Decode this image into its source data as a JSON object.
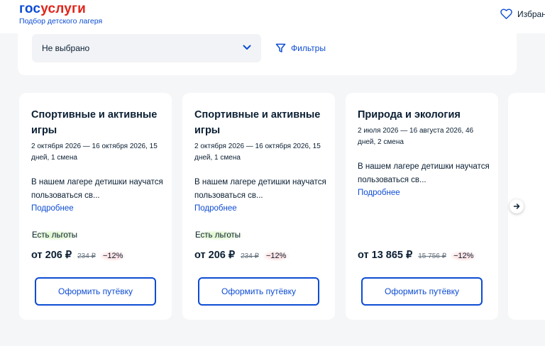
{
  "header": {
    "logo_part1": "гос",
    "logo_part2": "услуги",
    "subtitle": "Подбор детского лагеря",
    "favorites_label": "Избран"
  },
  "filter_bar": {
    "select_value": "Не выбрано",
    "filters_label": "Фильтры"
  },
  "cards": [
    {
      "title": "Спортивные и активные игры",
      "dates": "2 октября 2026 — 16 октября 2026, 15 дней, 1 смена",
      "description": "В нашем лагере детишки научатся пользоваться св...",
      "more_label": "Подробнее",
      "benefit": "Есть льготы",
      "price": "от 206 ₽",
      "old_price": "234 ₽",
      "discount": "−12%",
      "button_label": "Оформить путёвку"
    },
    {
      "title": "Спортивные и активные игры",
      "dates": "2 октября 2026 — 16 октября 2026, 15 дней, 1 смена",
      "description": "В нашем лагере детишки научатся пользоваться св...",
      "more_label": "Подробнее",
      "benefit": "Есть льготы",
      "price": "от 206 ₽",
      "old_price": "234 ₽",
      "discount": "−12%",
      "button_label": "Оформить путёвку"
    },
    {
      "title": "Природа и экология",
      "dates": "2 июля 2026 — 16 августа 2026, 46 дней, 2 смена",
      "description": "В нашем лагере детишки научатся пользоваться св...",
      "more_label": "Подробнее",
      "price": "от 13 865 ₽",
      "old_price": "15 756 ₽",
      "discount": "−12%",
      "button_label": "Оформить путёвку"
    }
  ],
  "icons": {
    "favorites": "heart-icon",
    "select": "chevron-down-icon",
    "filters": "filter-icon",
    "carousel_next": "arrow-right-icon"
  },
  "colors": {
    "brand_blue": "#0d4cd3",
    "brand_red": "#e1251b",
    "text": "#0b1f33",
    "page_bg": "#f5f6f8",
    "benefit_bg": "#e3f7d2",
    "discount_bg": "#fde3e3"
  }
}
